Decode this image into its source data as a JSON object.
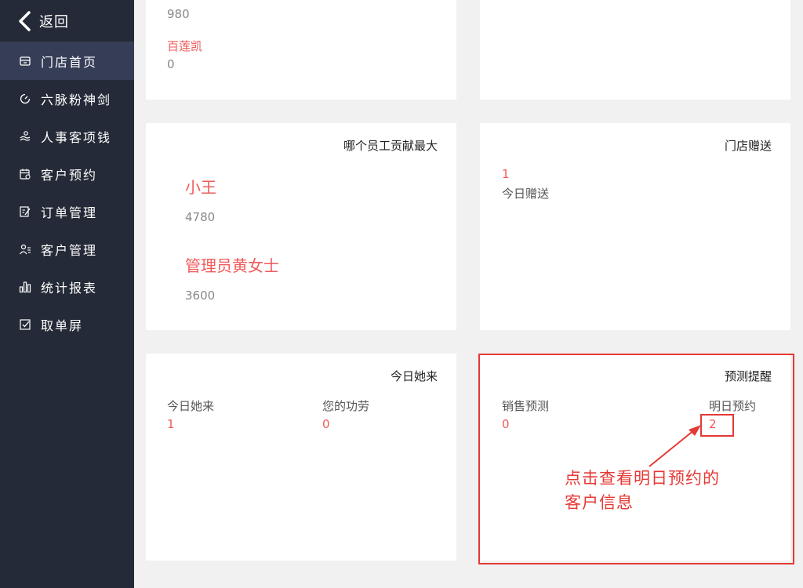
{
  "sidebar": {
    "back_label": "返回",
    "items": [
      {
        "label": "门店首页",
        "icon": "store-icon",
        "active": true
      },
      {
        "label": "六脉粉神剑",
        "icon": "gauge-icon"
      },
      {
        "label": "人事客项钱",
        "icon": "people-icon"
      },
      {
        "label": "客户预约",
        "icon": "calendar-icon"
      },
      {
        "label": "订单管理",
        "icon": "edit-note-icon"
      },
      {
        "label": "客户管理",
        "icon": "user-list-icon"
      },
      {
        "label": "统计报表",
        "icon": "bar-chart-icon"
      },
      {
        "label": "取单屏",
        "icon": "checkbox-icon"
      }
    ]
  },
  "card_top_left": {
    "value1": "980",
    "name": "百莲凯",
    "value2": "0"
  },
  "card_contrib": {
    "title": "哪个员工贡献最大",
    "people": [
      {
        "name": "小王",
        "value": "4780"
      },
      {
        "name": "管理员黄女士",
        "value": "3600"
      }
    ]
  },
  "card_gift": {
    "title": "门店赠送",
    "value": "1",
    "label": "今日赠送"
  },
  "card_today": {
    "title": "今日她来",
    "col1_label": "今日她来",
    "col1_value": "1",
    "col2_label": "您的功劳",
    "col2_value": "0"
  },
  "card_forecast": {
    "title": "预测提醒",
    "col1_label": "销售预测",
    "col1_value": "0",
    "col2_label": "明日预约",
    "col2_value": "2"
  },
  "annotation": {
    "line1": "点击查看明日预约的",
    "line2": "客户信息",
    "color": "#e53935"
  }
}
